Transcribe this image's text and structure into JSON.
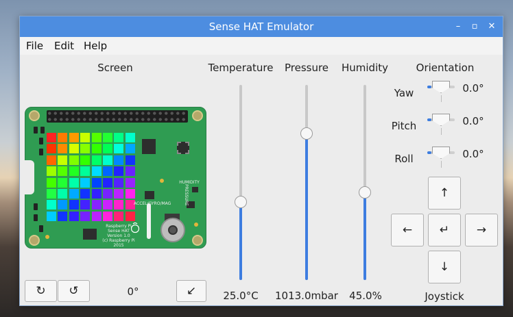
{
  "window": {
    "title": "Sense HAT Emulator",
    "controls": [
      "–",
      "▫",
      "✕"
    ]
  },
  "menu": {
    "items": [
      "File",
      "Edit",
      "Help"
    ]
  },
  "screen": {
    "label": "Screen",
    "rotate_cw": "↻",
    "rotate_ccw": "↺",
    "rotation_value": "0°",
    "corner_icon": "↙",
    "board_text": {
      "humidity": "HUMIDITY",
      "accel": "ACCEL/GYRO/MAG",
      "pressure": "PRESSURE",
      "logo_lines": [
        "Raspberry Pi",
        "Sense HAT",
        "Version 1.0",
        "(c) Raspberry Pi 2015"
      ]
    },
    "led_colors": [
      [
        "#ff2222",
        "#ff7a00",
        "#ff9a00",
        "#c8ff00",
        "#55ff00",
        "#22ff33",
        "#00ff88",
        "#00ffcc"
      ],
      [
        "#ff3300",
        "#ff8a00",
        "#d8ff00",
        "#88ff00",
        "#33ff00",
        "#00ff55",
        "#00ffdd",
        "#00a8ff"
      ],
      [
        "#ff6600",
        "#c5ff00",
        "#7fff00",
        "#33ff00",
        "#00ff66",
        "#00ffcc",
        "#0088ff",
        "#1133ff"
      ],
      [
        "#9dff00",
        "#55ff00",
        "#22ff22",
        "#00ff99",
        "#00ddff",
        "#0066ff",
        "#2222ff",
        "#6a22ff"
      ],
      [
        "#44ff00",
        "#22ff33",
        "#00ffaa",
        "#00ccff",
        "#0044ff",
        "#2222ff",
        "#5522ff",
        "#9922ff"
      ],
      [
        "#22ff44",
        "#00ffaa",
        "#00aaff",
        "#1133ff",
        "#3322ff",
        "#7722ff",
        "#bb22ff",
        "#ff22ee"
      ],
      [
        "#00ffcc",
        "#0099ff",
        "#1133ff",
        "#4422ff",
        "#8822ff",
        "#cc22ff",
        "#ff22cc",
        "#ff2299"
      ],
      [
        "#00ccff",
        "#1133ff",
        "#3322ff",
        "#7722ff",
        "#bb22ff",
        "#ff22dd",
        "#ff2277",
        "#ff2244"
      ]
    ]
  },
  "sensors": {
    "temperature": {
      "label": "Temperature",
      "value": "25.0°C",
      "level": 0.4
    },
    "pressure": {
      "label": "Pressure",
      "value": "1013.0mbar",
      "level": 0.75
    },
    "humidity": {
      "label": "Humidity",
      "value": "45.0%",
      "level": 0.45
    }
  },
  "orientation": {
    "label": "Orientation",
    "yaw": {
      "label": "Yaw",
      "value": "0.0°"
    },
    "pitch": {
      "label": "Pitch",
      "value": "0.0°"
    },
    "roll": {
      "label": "Roll",
      "value": "0.0°"
    }
  },
  "joystick": {
    "label": "Joystick",
    "up": "↑",
    "left": "←",
    "enter": "↵",
    "right": "→",
    "down": "↓"
  }
}
